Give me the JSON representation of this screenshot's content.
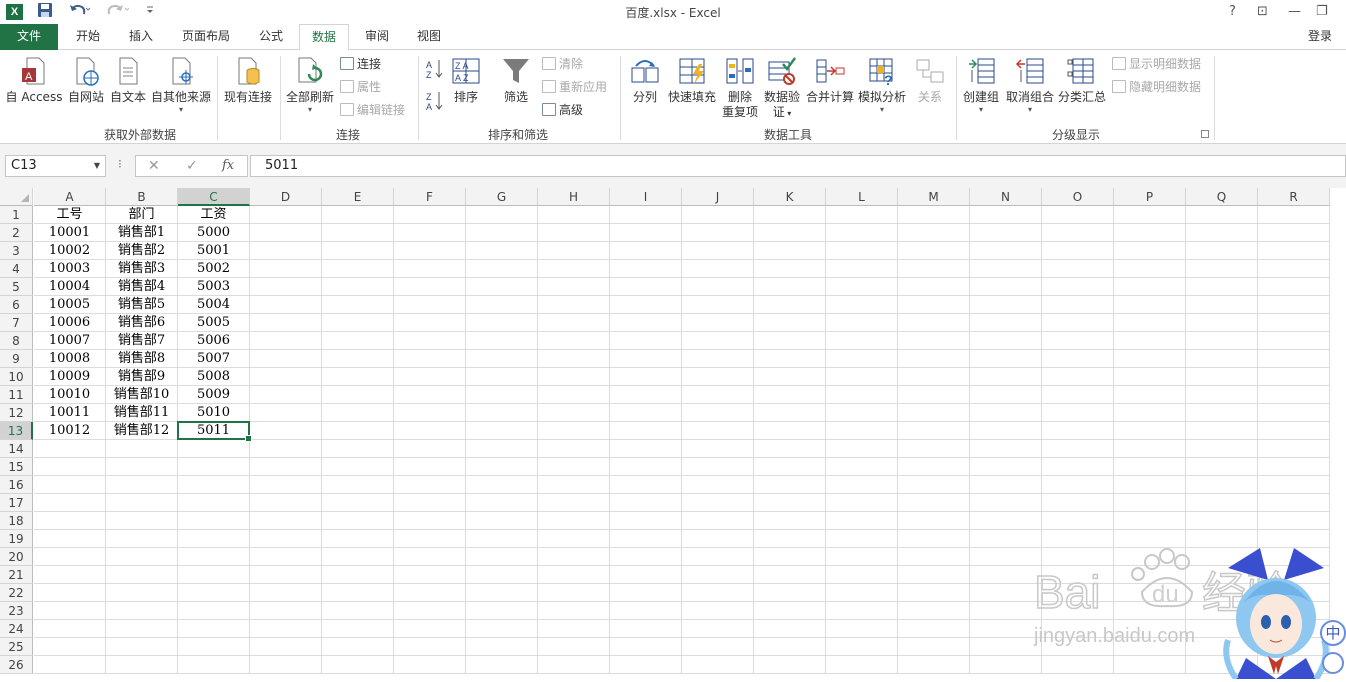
{
  "app": {
    "title": "百度.xlsx - Excel",
    "logo": "X"
  },
  "qat": {
    "save_icon": "save-icon",
    "undo_icon": "undo-icon",
    "redo_icon": "redo-icon",
    "customize_icon": "customize-qat-icon"
  },
  "window": {
    "help": "?",
    "restore_ribbon": "⊡",
    "minimize": "—",
    "restore": "❐"
  },
  "tabs": {
    "file": "文件",
    "items": [
      "开始",
      "插入",
      "页面布局",
      "公式",
      "数据",
      "审阅",
      "视图"
    ],
    "active": "数据",
    "login": "登录"
  },
  "ribbon": {
    "get_external": {
      "label": "获取外部数据",
      "access": "自 Access",
      "web": "自网站",
      "text": "自文本",
      "other": "自其他来源",
      "existing": "现有连接"
    },
    "connections": {
      "label": "连接",
      "refresh_all": "全部刷新",
      "connections": "连接",
      "properties": "属性",
      "edit_links": "编辑链接"
    },
    "sort_filter": {
      "label": "排序和筛选",
      "sort": "排序",
      "filter": "筛选",
      "clear": "清除",
      "reapply": "重新应用",
      "advanced": "高级"
    },
    "data_tools": {
      "label": "数据工具",
      "split": "分列",
      "flash_fill": "快速填充",
      "remove_dup_1": "删除",
      "remove_dup_2": "重复项",
      "validation_1": "数据验",
      "validation_2": "证",
      "consolidate": "合并计算",
      "whatif": "模拟分析",
      "relationships": "关系"
    },
    "outline": {
      "label": "分级显示",
      "group": "创建组",
      "ungroup": "取消组合",
      "subtotal": "分类汇总",
      "show_detail": "显示明细数据",
      "hide_detail": "隐藏明细数据"
    }
  },
  "formula_bar": {
    "name_box": "C13",
    "cancel": "✕",
    "enter": "✓",
    "fx": "fx",
    "value": "5011"
  },
  "columns": [
    "A",
    "B",
    "C",
    "D",
    "E",
    "F",
    "G",
    "H",
    "I",
    "J",
    "K",
    "L",
    "M",
    "N",
    "O",
    "P",
    "Q",
    "R"
  ],
  "rows": [
    "1",
    "2",
    "3",
    "4",
    "5",
    "6",
    "7",
    "8",
    "9",
    "10",
    "11",
    "12",
    "13",
    "14",
    "15",
    "16",
    "17",
    "18",
    "19",
    "20",
    "21",
    "22",
    "23",
    "24",
    "25",
    "26"
  ],
  "selected_cell": "C13",
  "table": {
    "headers": [
      "工号",
      "部门",
      "工资"
    ],
    "rows": [
      [
        "10001",
        "销售部1",
        "5000"
      ],
      [
        "10002",
        "销售部2",
        "5001"
      ],
      [
        "10003",
        "销售部3",
        "5002"
      ],
      [
        "10004",
        "销售部4",
        "5003"
      ],
      [
        "10005",
        "销售部5",
        "5004"
      ],
      [
        "10006",
        "销售部6",
        "5005"
      ],
      [
        "10007",
        "销售部7",
        "5006"
      ],
      [
        "10008",
        "销售部8",
        "5007"
      ],
      [
        "10009",
        "销售部9",
        "5008"
      ],
      [
        "10010",
        "销售部10",
        "5009"
      ],
      [
        "10011",
        "销售部11",
        "5010"
      ],
      [
        "10012",
        "销售部12",
        "5011"
      ]
    ]
  },
  "watermark": {
    "brand": "Bai du 经验",
    "url": "jingyan.baidu.com",
    "ime": "中"
  }
}
